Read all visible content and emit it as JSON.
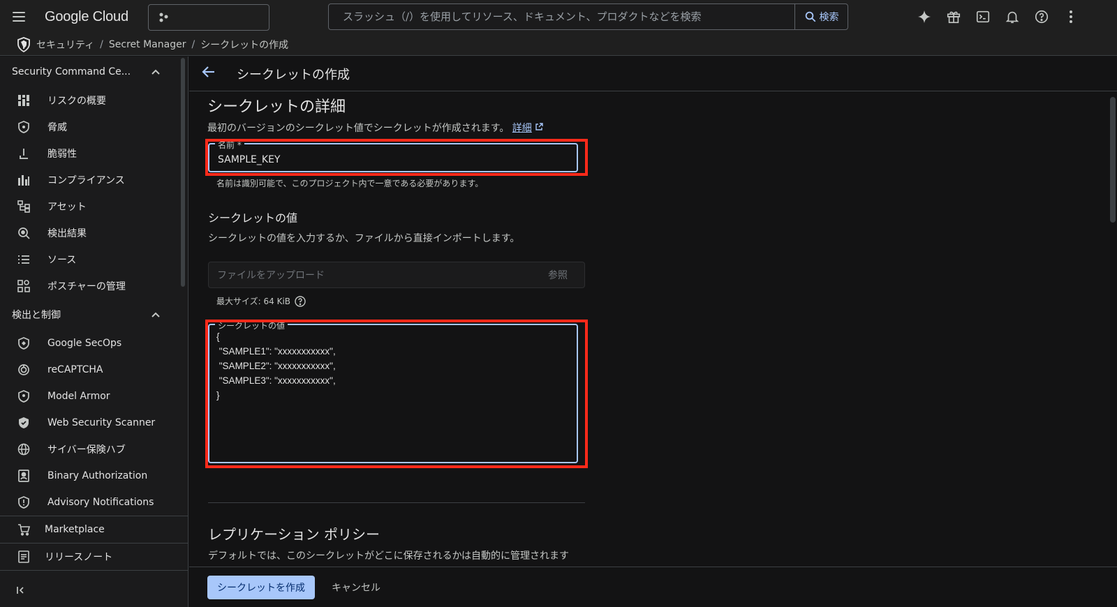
{
  "topbar": {
    "logo": "Google Cloud",
    "search_placeholder": "スラッシュ（/）を使用してリソース、ドキュメント、プロダクトなどを検索",
    "search_button": "検索",
    "icons": [
      "gemini-icon",
      "gift-icon",
      "cloud-shell-icon",
      "notifications-icon",
      "help-icon",
      "more-vert-icon"
    ]
  },
  "breadcrumb": {
    "items": [
      "セキュリティ",
      "Secret Manager",
      "シークレットの作成"
    ],
    "sep": "/"
  },
  "sidebar": {
    "section1": "Security Command Ce...",
    "items1": [
      {
        "label": "リスクの概要",
        "icon": "dashboard-icon"
      },
      {
        "label": "脅威",
        "icon": "shield-icon"
      },
      {
        "label": "脆弱性",
        "icon": "vulnerability-icon"
      },
      {
        "label": "コンプライアンス",
        "icon": "compliance-icon"
      },
      {
        "label": "アセット",
        "icon": "asset-icon"
      },
      {
        "label": "検出結果",
        "icon": "findings-icon"
      },
      {
        "label": "ソース",
        "icon": "list-icon"
      },
      {
        "label": "ポスチャーの管理",
        "icon": "posture-icon"
      }
    ],
    "section2": "検出と制御",
    "items2": [
      {
        "label": "Google SecOps",
        "icon": "shield-icon"
      },
      {
        "label": "reCAPTCHA",
        "icon": "recaptcha-icon"
      },
      {
        "label": "Model Armor",
        "icon": "shield-icon"
      },
      {
        "label": "Web Security Scanner",
        "icon": "shield-icon"
      },
      {
        "label": "サイバー保険ハブ",
        "icon": "globe-icon"
      },
      {
        "label": "Binary Authorization",
        "icon": "binary-icon"
      },
      {
        "label": "Advisory Notifications",
        "icon": "shield-icon"
      }
    ],
    "marketplace": "Marketplace",
    "release_notes": "リリースノート"
  },
  "main": {
    "page_title": "シークレットの作成",
    "details_heading": "シークレットの詳細",
    "details_desc": "最初のバージョンのシークレット値でシークレットが作成されます。",
    "details_link": "詳細",
    "name_label": "名前 *",
    "name_value": "SAMPLE_KEY",
    "name_hint": "名前は識別可能で、このプロジェクト内で一意である必要があります。",
    "value_heading": "シークレットの値",
    "value_desc": "シークレットの値を入力するか、ファイルから直接インポートします。",
    "upload_placeholder": "ファイルをアップロード",
    "upload_browse": "参照",
    "max_size": "最大サイズ: 64 KiB",
    "value_label": "シークレットの値",
    "value_text": "{\n \"SAMPLE1\": \"xxxxxxxxxxx\",\n \"SAMPLE2\": \"xxxxxxxxxxx\",\n \"SAMPLE3\": \"xxxxxxxxxxx\",\n}",
    "replication_heading": "レプリケーション ポリシー",
    "replication_desc": "デフォルトでは、このシークレットがどこに保存されるかは自動的に管理されます"
  },
  "footer": {
    "create_button": "シークレットを作成",
    "cancel_button": "キャンセル"
  },
  "colors": {
    "accent": "#a8c7fa",
    "highlight": "#ff2a1a",
    "background": "#131314"
  }
}
